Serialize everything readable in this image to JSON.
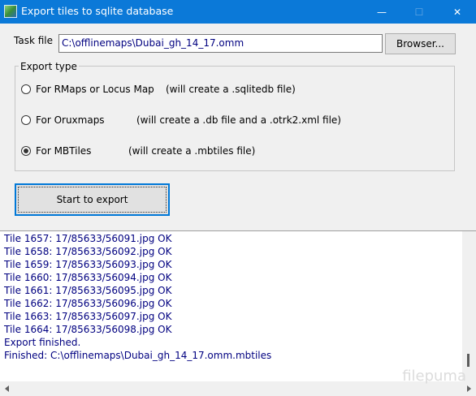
{
  "window": {
    "title": "Export tiles to sqlite database",
    "minimize_glyph": "—",
    "maximize_glyph": "☐",
    "close_glyph": "✕"
  },
  "task": {
    "label": "Task file",
    "value": "C:\\offlinemaps\\Dubai_gh_14_17.omm",
    "browse_label": "Browser..."
  },
  "export_type": {
    "label": "Export type",
    "options": [
      {
        "label": "For RMaps or Locus Map",
        "note": "(will create a .sqlitedb file)",
        "selected": false
      },
      {
        "label": "For Oruxmaps",
        "note": "(will create a .db file and a .otrk2.xml file)",
        "selected": false
      },
      {
        "label": "For MBTiles",
        "note": "(will create a .mbtiles file)",
        "selected": true
      }
    ]
  },
  "start_button": "Start to export",
  "log": {
    "lines": [
      "Tile 1657: 17/85633/56091.jpg OK",
      "Tile 1658: 17/85633/56092.jpg OK",
      "Tile 1659: 17/85633/56093.jpg OK",
      "Tile 1660: 17/85633/56094.jpg OK",
      "Tile 1661: 17/85633/56095.jpg OK",
      "Tile 1662: 17/85633/56096.jpg OK",
      "Tile 1663: 17/85633/56097.jpg OK",
      "Tile 1664: 17/85633/56098.jpg OK",
      "Export finished.",
      "Finished: C:\\offlinemaps\\Dubai_gh_14_17.omm.mbtiles"
    ]
  },
  "watermark": "filepuma",
  "colors": {
    "titlebar": "#0b79d8",
    "log_text": "#000080",
    "focus_border": "#0078d7"
  }
}
